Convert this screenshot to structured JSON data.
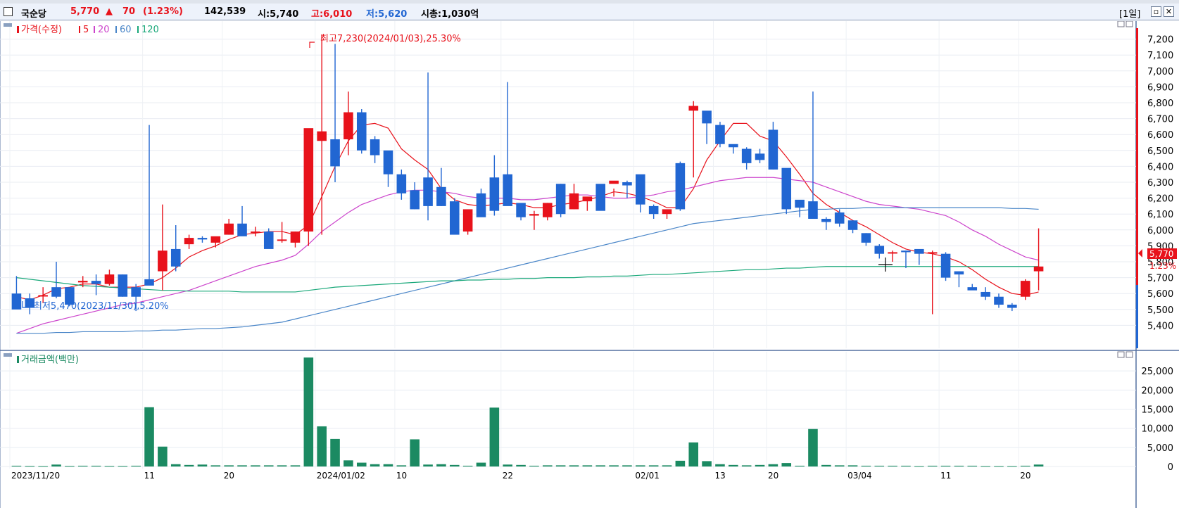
{
  "window": {
    "stock_name": "국순당",
    "price": "5,770",
    "change_arrow": "▲",
    "change": "70",
    "change_pct": "(1.23%)",
    "volume": "142,539",
    "open": "시:5,740",
    "high": "고:6,010",
    "low": "저:5,620",
    "market_cap": "시총:1,030억",
    "period_button": "[1일]",
    "restore_icon": "restore-icon",
    "close_icon": "close-icon"
  },
  "price_panel": {
    "legend_title": "가격(수정)",
    "ma_legend": [
      "5",
      "20",
      "60",
      "120"
    ],
    "high_annotation": "최고7,230(2024/01/03),25.30%",
    "low_annotation": "최저5,470(2023/11/30),5.20%",
    "current_price_tag": "5,770",
    "current_pct_tag": "1.23%"
  },
  "volume_panel": {
    "legend_title": "거래금액(백만)"
  },
  "colors": {
    "up": "#e8121b",
    "down": "#2166d2",
    "ma5": "#e8121b",
    "ma20": "#cc44cc",
    "ma60": "#4a86c8",
    "ma120": "#1aa87a",
    "volume": "#1b8a62"
  },
  "chart_data": [
    {
      "type": "candlestick",
      "title": "가격(수정)",
      "ylim": [
        5300,
        7300
      ],
      "y_ticks": [
        "7,200",
        "7,100",
        "7,000",
        "6,900",
        "6,800",
        "6,700",
        "6,600",
        "6,500",
        "6,400",
        "6,300",
        "6,200",
        "6,100",
        "6,000",
        "5,900",
        "5,800",
        "5,700",
        "5,600",
        "5,500",
        "5,400"
      ],
      "x_labels": [
        "2023/11/20",
        "11",
        "20",
        "2024/01/02",
        "10",
        "22",
        "02/01",
        "13",
        "20",
        "03/04",
        "11",
        "20"
      ],
      "candles": [
        [
          5600,
          5710,
          5580,
          5500
        ],
        [
          5570,
          5600,
          5470,
          5510
        ],
        [
          5590,
          5640,
          5540,
          5590
        ],
        [
          5640,
          5800,
          5570,
          5580
        ],
        [
          5640,
          5600,
          5520,
          5530
        ],
        [
          5670,
          5710,
          5640,
          5680
        ],
        [
          5680,
          5720,
          5590,
          5660
        ],
        [
          5660,
          5750,
          5650,
          5720
        ],
        [
          5720,
          5720,
          5580,
          5580
        ],
        [
          5640,
          5660,
          5490,
          5580
        ],
        [
          5690,
          6660,
          5690,
          5650
        ],
        [
          5740,
          6160,
          5620,
          5870
        ],
        [
          5880,
          6030,
          5740,
          5770
        ],
        [
          5910,
          5970,
          5880,
          5950
        ],
        [
          5950,
          5960,
          5920,
          5940
        ],
        [
          5920,
          5950,
          5890,
          5960
        ],
        [
          5970,
          6070,
          5970,
          6040
        ],
        [
          6040,
          6150,
          6000,
          5960
        ],
        [
          5990,
          6020,
          5960,
          5990
        ],
        [
          5990,
          6010,
          5910,
          5880
        ],
        [
          5940,
          6050,
          5920,
          5940
        ],
        [
          5920,
          5990,
          5890,
          5990
        ],
        [
          5990,
          6520,
          5900,
          6640
        ],
        [
          6560,
          7230,
          5970,
          6620
        ],
        [
          6570,
          7170,
          6300,
          6400
        ],
        [
          6570,
          6870,
          6470,
          6740
        ],
        [
          6740,
          6760,
          6480,
          6500
        ],
        [
          6570,
          6590,
          6420,
          6470
        ],
        [
          6500,
          6470,
          6270,
          6350
        ],
        [
          6350,
          6380,
          6190,
          6230
        ],
        [
          6250,
          6300,
          6130,
          6130
        ],
        [
          6330,
          6990,
          6060,
          6150
        ],
        [
          6270,
          6390,
          6150,
          6150
        ],
        [
          6180,
          6200,
          5980,
          5970
        ],
        [
          5990,
          6100,
          5970,
          6130
        ],
        [
          6230,
          6260,
          6100,
          6080
        ],
        [
          6330,
          6470,
          6090,
          6120
        ],
        [
          6350,
          6930,
          6160,
          6150
        ],
        [
          6170,
          6160,
          6060,
          6080
        ],
        [
          6090,
          6120,
          6000,
          6100
        ],
        [
          6080,
          6170,
          6060,
          6170
        ],
        [
          6290,
          6290,
          6080,
          6100
        ],
        [
          6130,
          6290,
          6130,
          6230
        ],
        [
          6180,
          6200,
          6120,
          6210
        ],
        [
          6290,
          6280,
          6140,
          6120
        ],
        [
          6290,
          6260,
          6210,
          6310
        ],
        [
          6300,
          6310,
          6200,
          6280
        ],
        [
          6350,
          6250,
          6110,
          6160
        ],
        [
          6150,
          6160,
          6070,
          6100
        ],
        [
          6100,
          6120,
          6070,
          6130
        ],
        [
          6420,
          6430,
          6120,
          6130
        ],
        [
          6750,
          6810,
          6330,
          6780
        ],
        [
          6750,
          6730,
          6540,
          6670
        ],
        [
          6660,
          6680,
          6520,
          6540
        ],
        [
          6540,
          6530,
          6480,
          6520
        ],
        [
          6510,
          6520,
          6380,
          6420
        ],
        [
          6480,
          6510,
          6420,
          6440
        ],
        [
          6630,
          6680,
          6380,
          6380
        ],
        [
          6390,
          6380,
          6100,
          6130
        ],
        [
          6190,
          6160,
          6080,
          6140
        ],
        [
          6180,
          6870,
          6080,
          6070
        ],
        [
          6070,
          6080,
          6000,
          6050
        ],
        [
          6110,
          6130,
          6020,
          6040
        ],
        [
          6060,
          6060,
          5980,
          6000
        ],
        [
          5980,
          5980,
          5900,
          5920
        ],
        [
          5900,
          5910,
          5820,
          5850
        ],
        [
          5860,
          5870,
          5800,
          5860
        ],
        [
          5870,
          5870,
          5760,
          5860
        ],
        [
          5880,
          5870,
          5780,
          5850
        ],
        [
          5860,
          5870,
          5470,
          5860
        ],
        [
          5850,
          5860,
          5680,
          5700
        ],
        [
          5740,
          5740,
          5640,
          5720
        ],
        [
          5640,
          5660,
          5630,
          5620
        ],
        [
          5610,
          5640,
          5560,
          5580
        ],
        [
          5580,
          5600,
          5510,
          5530
        ],
        [
          5530,
          5540,
          5490,
          5510
        ],
        [
          5580,
          5690,
          5560,
          5680
        ],
        [
          5740,
          6010,
          5620,
          5770
        ]
      ],
      "series": [
        {
          "name": "5",
          "values": [
            5580,
            5560,
            5590,
            5630,
            5640,
            5660,
            5660,
            5640,
            5640,
            5640,
            5660,
            5700,
            5760,
            5830,
            5870,
            5900,
            5940,
            5970,
            5980,
            5990,
            5990,
            5970,
            6030,
            6210,
            6400,
            6560,
            6660,
            6670,
            6640,
            6510,
            6440,
            6380,
            6260,
            6190,
            6160,
            6150,
            6160,
            6170,
            6160,
            6140,
            6140,
            6160,
            6170,
            6190,
            6210,
            6240,
            6230,
            6210,
            6180,
            6140,
            6140,
            6260,
            6440,
            6560,
            6670,
            6670,
            6590,
            6560,
            6460,
            6350,
            6230,
            6160,
            6110,
            6060,
            6020,
            5970,
            5920,
            5880,
            5860,
            5850,
            5830,
            5800,
            5750,
            5690,
            5640,
            5600,
            5590,
            5610
          ]
        },
        {
          "name": "20",
          "values": [
            5350,
            5380,
            5410,
            5430,
            5450,
            5470,
            5490,
            5510,
            5530,
            5540,
            5560,
            5580,
            5600,
            5620,
            5650,
            5680,
            5710,
            5740,
            5770,
            5790,
            5810,
            5840,
            5910,
            5990,
            6050,
            6110,
            6160,
            6190,
            6220,
            6240,
            6250,
            6250,
            6240,
            6230,
            6210,
            6200,
            6200,
            6200,
            6190,
            6190,
            6200,
            6210,
            6220,
            6220,
            6210,
            6200,
            6200,
            6210,
            6220,
            6240,
            6250,
            6270,
            6290,
            6310,
            6320,
            6330,
            6330,
            6330,
            6320,
            6310,
            6300,
            6270,
            6240,
            6210,
            6180,
            6160,
            6150,
            6140,
            6130,
            6110,
            6090,
            6050,
            6000,
            5960,
            5910,
            5870,
            5830,
            5810
          ]
        },
        {
          "name": "60",
          "values": [
            5350,
            5350,
            5350,
            5355,
            5355,
            5360,
            5360,
            5360,
            5360,
            5365,
            5365,
            5370,
            5370,
            5375,
            5380,
            5380,
            5385,
            5390,
            5400,
            5410,
            5420,
            5440,
            5460,
            5480,
            5500,
            5520,
            5540,
            5560,
            5580,
            5600,
            5620,
            5640,
            5660,
            5680,
            5700,
            5720,
            5740,
            5760,
            5780,
            5800,
            5820,
            5840,
            5860,
            5880,
            5900,
            5920,
            5940,
            5960,
            5980,
            6000,
            6020,
            6040,
            6050,
            6060,
            6070,
            6080,
            6090,
            6100,
            6110,
            6120,
            6130,
            6130,
            6135,
            6135,
            6140,
            6140,
            6140,
            6140,
            6140,
            6140,
            6140,
            6140,
            6140,
            6140,
            6140,
            6135,
            6135,
            6130
          ]
        },
        {
          "name": "120",
          "values": [
            5700,
            5690,
            5680,
            5670,
            5660,
            5650,
            5645,
            5640,
            5635,
            5630,
            5625,
            5620,
            5620,
            5615,
            5615,
            5615,
            5615,
            5610,
            5610,
            5610,
            5610,
            5610,
            5620,
            5630,
            5640,
            5645,
            5650,
            5655,
            5660,
            5665,
            5670,
            5675,
            5680,
            5680,
            5685,
            5685,
            5690,
            5690,
            5695,
            5695,
            5700,
            5700,
            5700,
            5705,
            5705,
            5710,
            5710,
            5715,
            5720,
            5720,
            5725,
            5730,
            5735,
            5740,
            5745,
            5750,
            5750,
            5755,
            5760,
            5760,
            5765,
            5770,
            5770,
            5770,
            5770,
            5770,
            5770,
            5770,
            5770,
            5770,
            5770,
            5770,
            5770,
            5770,
            5770,
            5770,
            5770,
            5770
          ]
        }
      ]
    },
    {
      "type": "bar",
      "title": "거래금액(백만)",
      "ylim": [
        0,
        30000
      ],
      "y_ticks": [
        "25,000",
        "20,000",
        "15,000",
        "10,000",
        "5,000",
        "0"
      ],
      "values": [
        200,
        150,
        100,
        500,
        150,
        200,
        200,
        150,
        150,
        200,
        15500,
        5200,
        600,
        400,
        500,
        300,
        300,
        300,
        300,
        300,
        300,
        300,
        28500,
        10500,
        7200,
        1600,
        1000,
        600,
        600,
        300,
        7100,
        500,
        600,
        400,
        200,
        1000,
        15400,
        500,
        400,
        200,
        300,
        300,
        300,
        300,
        300,
        300,
        300,
        300,
        300,
        300,
        1500,
        6300,
        1400,
        600,
        400,
        300,
        400,
        600,
        900,
        200,
        9800,
        400,
        300,
        300,
        200,
        200,
        200,
        200,
        100,
        200,
        200,
        200,
        200,
        100,
        100,
        100,
        200,
        500
      ]
    }
  ]
}
